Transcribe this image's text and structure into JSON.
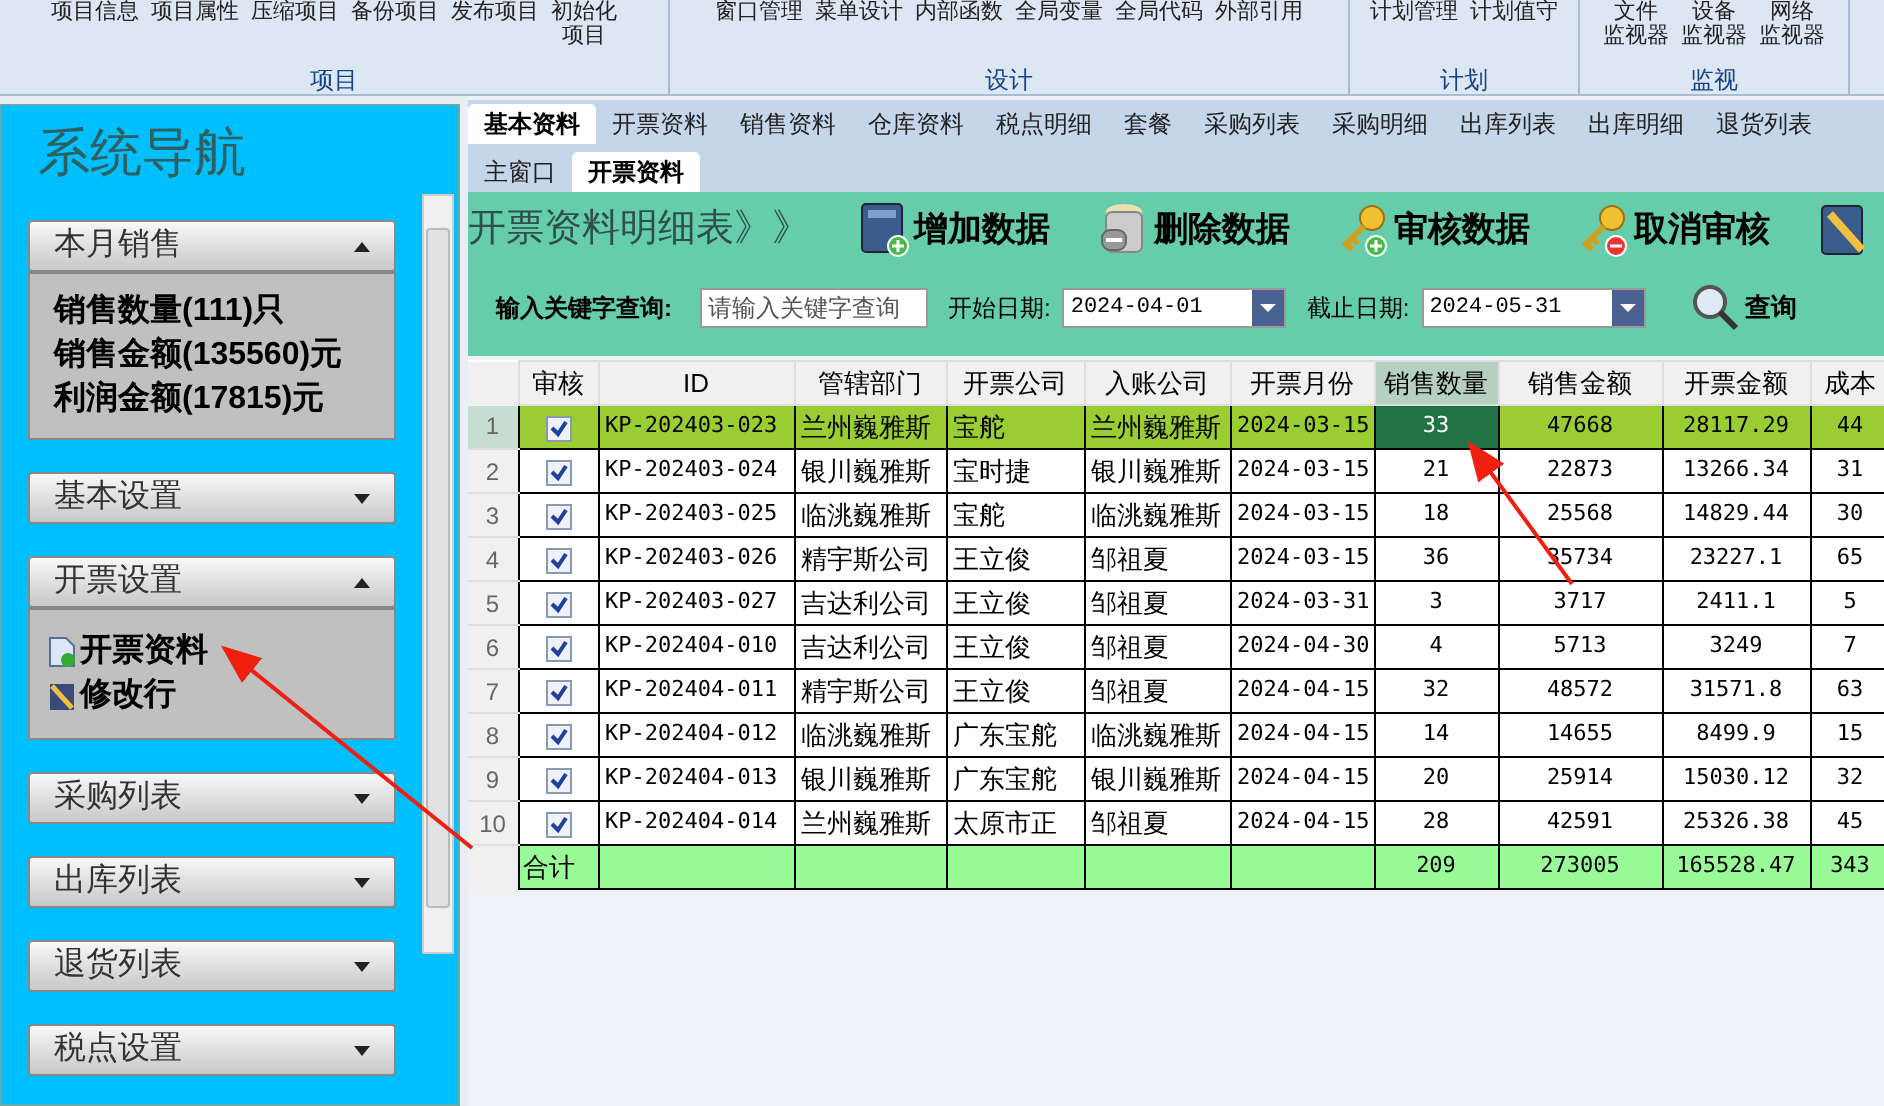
{
  "ribbon": {
    "groups": [
      {
        "label": "项目",
        "buttons": [
          [
            "项目信息"
          ],
          [
            "项目属性"
          ],
          [
            "压缩项目"
          ],
          [
            "备份项目"
          ],
          [
            "发布项目"
          ],
          [
            "初始化",
            "项目"
          ]
        ]
      },
      {
        "label": "设计",
        "buttons": [
          [
            "窗口管理"
          ],
          [
            "菜单设计"
          ],
          [
            "内部函数"
          ],
          [
            "全局变量"
          ],
          [
            "全局代码"
          ],
          [
            "外部引用"
          ]
        ]
      },
      {
        "label": "计划",
        "buttons": [
          [
            "计划管理"
          ],
          [
            "计划值守"
          ]
        ]
      },
      {
        "label": "监视",
        "buttons": [
          [
            "文件",
            "监视器"
          ],
          [
            "设备",
            "监视器"
          ],
          [
            "网络",
            "监视器"
          ]
        ]
      }
    ]
  },
  "sidebar": {
    "title": "系统导航",
    "sections": [
      {
        "title": "本月销售",
        "expanded": true,
        "lines": [
          {
            "kind": "stat",
            "text": "销售数量(111)只"
          },
          {
            "kind": "stat",
            "text": "销售金额(135560)元"
          },
          {
            "kind": "stat",
            "text": "利润金额(17815)元"
          }
        ]
      },
      {
        "title": "基本设置",
        "expanded": false
      },
      {
        "title": "开票设置",
        "expanded": true,
        "lines": [
          {
            "kind": "document",
            "text": "开票资料"
          },
          {
            "kind": "pencil",
            "text": "修改行"
          }
        ]
      },
      {
        "title": "采购列表",
        "expanded": false
      },
      {
        "title": "出库列表",
        "expanded": false
      },
      {
        "title": "退货列表",
        "expanded": false
      },
      {
        "title": "税点设置",
        "expanded": false
      }
    ]
  },
  "tabs": [
    {
      "label": "基本资料",
      "selected": true
    },
    {
      "label": "开票资料",
      "selected": false
    },
    {
      "label": "销售资料",
      "selected": false
    },
    {
      "label": "仓库资料",
      "selected": false
    },
    {
      "label": "税点明细",
      "selected": false
    },
    {
      "label": "套餐",
      "selected": false
    },
    {
      "label": "采购列表",
      "selected": false
    },
    {
      "label": "采购明细",
      "selected": false
    },
    {
      "label": "出库列表",
      "selected": false
    },
    {
      "label": "出库明细",
      "selected": false
    },
    {
      "label": "退货列表",
      "selected": false
    }
  ],
  "subtabs": [
    {
      "label": "主窗口",
      "selected": false
    },
    {
      "label": "开票资料",
      "selected": true
    }
  ],
  "toolbar": {
    "title": "开票资料明细表》》",
    "buttons": [
      {
        "kind": "book-add",
        "label": "增加数据"
      },
      {
        "kind": "bin",
        "label": "删除数据"
      },
      {
        "kind": "key-add",
        "label": "审核数据"
      },
      {
        "kind": "key-remove",
        "label": "取消审核"
      },
      {
        "kind": "notebook"
      }
    ]
  },
  "search": {
    "label": "输入关键字查询:",
    "placeholder": "请输入关键字查询",
    "start_label": "开始日期:",
    "start_date": "2024-04-01",
    "end_label": "截止日期:",
    "end_date": "2024-05-31",
    "button": "查询"
  },
  "table": {
    "columns": [
      {
        "label": "审核",
        "selected": false
      },
      {
        "label": "ID",
        "selected": false
      },
      {
        "label": "管辖部门",
        "selected": false
      },
      {
        "label": "开票公司",
        "selected": false
      },
      {
        "label": "入账公司",
        "selected": false
      },
      {
        "label": "开票月份",
        "selected": false
      },
      {
        "label": "销售数量",
        "selected": true
      },
      {
        "label": "销售金额",
        "selected": false
      },
      {
        "label": "开票金额",
        "selected": false
      },
      {
        "label": "成本",
        "selected": false
      }
    ],
    "rows": [
      {
        "number": "1",
        "selected": true,
        "checked": true,
        "cells": [
          "",
          "KP-202403-023",
          "兰州巍雅斯",
          "宝舵",
          "兰州巍雅斯",
          "2024-03-15",
          "33",
          "47668",
          "28117.29",
          "44"
        ]
      },
      {
        "number": "2",
        "selected": false,
        "checked": true,
        "cells": [
          "",
          "KP-202403-024",
          "银川巍雅斯",
          "宝时捷",
          "银川巍雅斯",
          "2024-03-15",
          "21",
          "22873",
          "13266.34",
          "31"
        ]
      },
      {
        "number": "3",
        "selected": false,
        "checked": true,
        "cells": [
          "",
          "KP-202403-025",
          "临洮巍雅斯",
          "宝舵",
          "临洮巍雅斯",
          "2024-03-15",
          "18",
          "25568",
          "14829.44",
          "30"
        ]
      },
      {
        "number": "4",
        "selected": false,
        "checked": true,
        "cells": [
          "",
          "KP-202403-026",
          "精宇斯公司",
          "王立俊",
          "邹祖夏",
          "2024-03-15",
          "36",
          "35734",
          "23227.1",
          "65"
        ]
      },
      {
        "number": "5",
        "selected": false,
        "checked": true,
        "cells": [
          "",
          "KP-202403-027",
          "吉达利公司",
          "王立俊",
          "邹祖夏",
          "2024-03-31",
          "3",
          "3717",
          "2411.1",
          "5"
        ]
      },
      {
        "number": "6",
        "selected": false,
        "checked": true,
        "cells": [
          "",
          "KP-202404-010",
          "吉达利公司",
          "王立俊",
          "邹祖夏",
          "2024-04-30",
          "4",
          "5713",
          "3249",
          "7"
        ]
      },
      {
        "number": "7",
        "selected": false,
        "checked": true,
        "cells": [
          "",
          "KP-202404-011",
          "精宇斯公司",
          "王立俊",
          "邹祖夏",
          "2024-04-15",
          "32",
          "48572",
          "31571.8",
          "63"
        ]
      },
      {
        "number": "8",
        "selected": false,
        "checked": true,
        "cells": [
          "",
          "KP-202404-012",
          "临洮巍雅斯",
          "广东宝舵",
          "临洮巍雅斯",
          "2024-04-15",
          "14",
          "14655",
          "8499.9",
          "15"
        ]
      },
      {
        "number": "9",
        "selected": false,
        "checked": true,
        "cells": [
          "",
          "KP-202404-013",
          "银川巍雅斯",
          "广东宝舵",
          "银川巍雅斯",
          "2024-04-15",
          "20",
          "25914",
          "15030.12",
          "32"
        ]
      },
      {
        "number": "10",
        "selected": false,
        "checked": true,
        "cells": [
          "",
          "KP-202404-014",
          "兰州巍雅斯",
          "太原市正",
          "邹祖夏",
          "2024-04-15",
          "28",
          "42591",
          "25326.38",
          "45"
        ]
      }
    ],
    "total": {
      "cells": [
        "合计",
        "",
        "",
        "",
        "",
        "",
        "209",
        "273005",
        "165528.47",
        "343"
      ]
    }
  }
}
